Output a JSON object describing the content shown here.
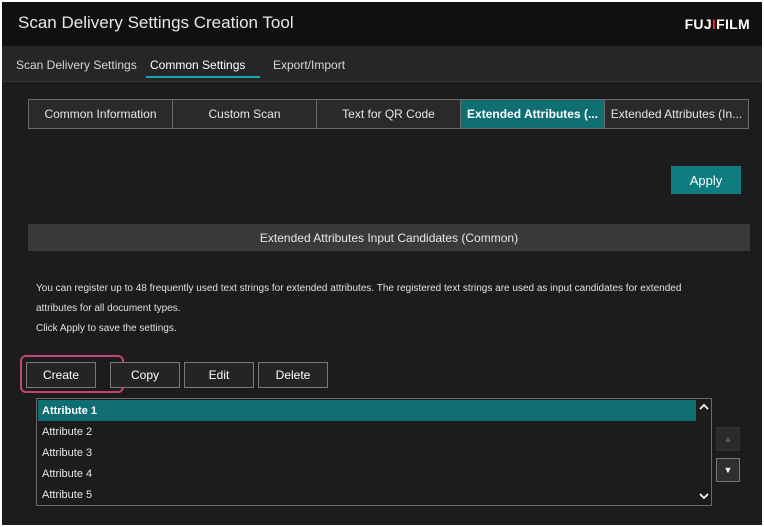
{
  "app": {
    "title": "Scan Delivery Settings Creation Tool",
    "brand_prefix": "FUJ",
    "brand_dot": "I",
    "brand_suffix": "FILM"
  },
  "nav": {
    "tabs": [
      {
        "label": "Scan Delivery Settings"
      },
      {
        "label": "Common Settings",
        "active": true
      },
      {
        "label": "Export/Import"
      }
    ]
  },
  "subtabs": [
    {
      "label": "Common Information"
    },
    {
      "label": "Custom Scan"
    },
    {
      "label": "Text for QR Code"
    },
    {
      "label": "Extended Attributes (...",
      "active": true
    },
    {
      "label": "Extended Attributes (In..."
    }
  ],
  "apply_label": "Apply",
  "section_title": "Extended Attributes Input Candidates (Common)",
  "description": {
    "line1": "You can register up to 48 frequently used text strings for extended attributes. The registered text strings are used as input candidates for extended",
    "line2": "attributes for all document types.",
    "line3": "Click Apply to save the settings."
  },
  "actions": {
    "create": "Create",
    "copy": "Copy",
    "edit": "Edit",
    "delete": "Delete"
  },
  "attributes": [
    {
      "label": "Attribute 1",
      "selected": true
    },
    {
      "label": "Attribute 2"
    },
    {
      "label": "Attribute 3"
    },
    {
      "label": "Attribute 4"
    },
    {
      "label": "Attribute 5"
    }
  ],
  "icons": {
    "scroll_up": "chevron-up-icon",
    "scroll_down": "chevron-down-icon",
    "move_up": "triangle-up-icon",
    "move_down": "triangle-down-icon"
  },
  "colors": {
    "accent": "#0f6e72",
    "apply": "#0f7c80",
    "highlight": "#c0447a",
    "brand_dot": "#e8242b"
  }
}
